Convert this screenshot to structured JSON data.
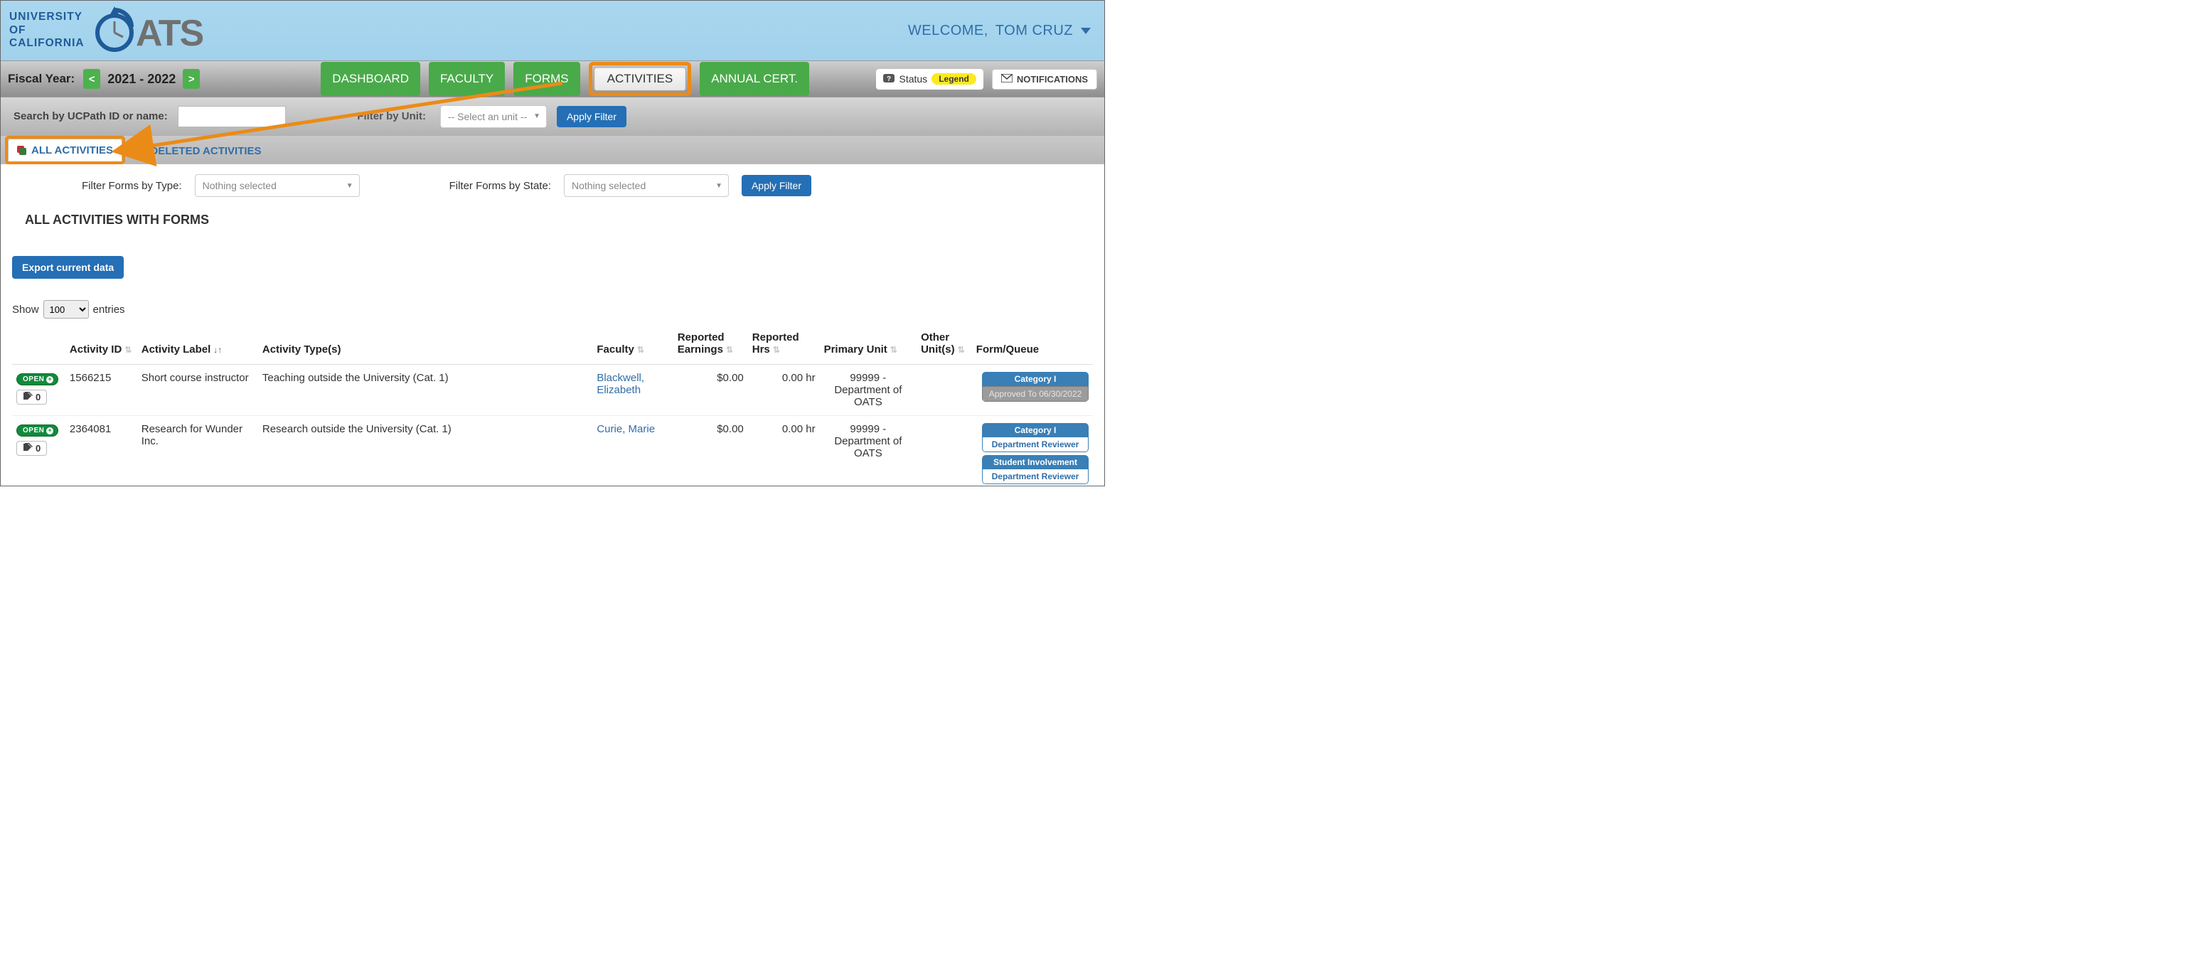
{
  "brand": {
    "line1": "UNIVERSITY",
    "line2": "OF",
    "line3": "CALIFORNIA",
    "logo_text": "ATS"
  },
  "welcome": {
    "prefix": "WELCOME, ",
    "name": "TOM CRUZ"
  },
  "nav": {
    "fiscal_label": "Fiscal Year:",
    "prev": "<",
    "next": ">",
    "year": "2021 - 2022",
    "tabs": {
      "dashboard": "DASHBOARD",
      "faculty": "FACULTY",
      "forms": "FORMS",
      "activities": "ACTIVITIES",
      "annual": "ANNUAL CERT."
    },
    "status_label": "Status",
    "legend": "Legend",
    "notifications": "NOTIFICATIONS"
  },
  "search": {
    "label": "Search by UCPath ID or name:",
    "unit_label": "Filter by Unit:",
    "unit_placeholder": "-- Select an unit --",
    "apply": "Apply Filter"
  },
  "subtabs": {
    "all": "ALL ACTIVITIES",
    "deleted": "DELETED ACTIVITIES"
  },
  "filters": {
    "type_label": "Filter Forms by Type:",
    "type_value": "Nothing selected",
    "state_label": "Filter Forms by State:",
    "state_value": "Nothing selected",
    "apply": "Apply Filter"
  },
  "heading": "ALL ACTIVITIES WITH FORMS",
  "export_btn": "Export current data",
  "entries": {
    "show": "Show",
    "value": "100",
    "suffix": "entries"
  },
  "columns": {
    "activity_id": "Activity ID",
    "activity_label": "Activity Label",
    "activity_types": "Activity Type(s)",
    "faculty": "Faculty",
    "earnings": "Reported Earnings",
    "hrs": "Reported Hrs",
    "primary_unit": "Primary Unit",
    "other_units": "Other Unit(s)",
    "form_queue": "Form/Queue"
  },
  "rows": [
    {
      "open": "OPEN",
      "tag_count": "0",
      "id": "1566215",
      "label": "Short course instructor",
      "type": "Teaching outside the University (Cat. 1)",
      "faculty": "Blackwell, Elizabeth",
      "earnings": "$0.00",
      "hrs": "0.00 hr",
      "unit": "99999 - Department of OATS",
      "forms": [
        {
          "head": "Category I",
          "body": "Approved To 06/30/2022",
          "style": "approved"
        }
      ]
    },
    {
      "open": "OPEN",
      "tag_count": "0",
      "id": "2364081",
      "label": "Research for Wunder Inc.",
      "type": "Research outside the University (Cat. 1)",
      "faculty": "Curie, Marie",
      "earnings": "$0.00",
      "hrs": "0.00 hr",
      "unit": "99999 - Department of OATS",
      "forms": [
        {
          "head": "Category I",
          "body": "Department Reviewer",
          "style": "dept"
        },
        {
          "head": "Student Involvement",
          "body": "Department Reviewer",
          "style": "dept"
        }
      ]
    }
  ]
}
